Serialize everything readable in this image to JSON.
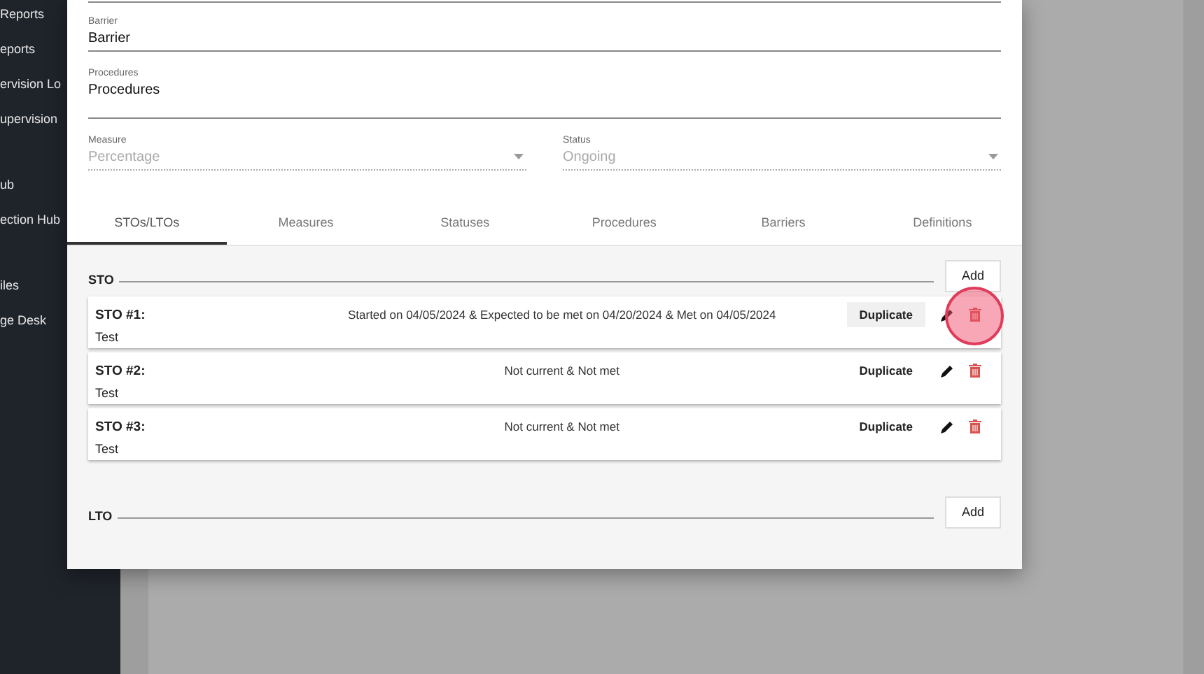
{
  "sidebar": {
    "items": [
      {
        "label": "Reports"
      },
      {
        "label": "eports"
      },
      {
        "label": "ervision Lo"
      },
      {
        "label": "upervision"
      },
      {
        "label": "ub"
      },
      {
        "label": "ection Hub"
      },
      {
        "label": "iles"
      },
      {
        "label": "ge Desk"
      }
    ]
  },
  "dialog": {
    "text_fields": [
      {
        "label": "Barrier",
        "value": "Barrier"
      },
      {
        "label": "Procedures",
        "value": "Procedures"
      }
    ],
    "selects": [
      {
        "label": "Measure",
        "value": "Percentage",
        "disabled": true
      },
      {
        "label": "Status",
        "value": "Ongoing",
        "disabled": true
      }
    ],
    "tabs": [
      {
        "label": "STOs/LTOs",
        "selected": true
      },
      {
        "label": "Measures",
        "selected": false
      },
      {
        "label": "Statuses",
        "selected": false
      },
      {
        "label": "Procedures",
        "selected": false
      },
      {
        "label": "Barriers",
        "selected": false
      },
      {
        "label": "Definitions",
        "selected": false
      }
    ],
    "sections": [
      {
        "title": "STO",
        "add_button": "Add",
        "items": [
          {
            "name": "STO #1:",
            "status": "Started on 04/05/2024 & Expected to be met on 04/20/2024 & Met on 04/05/2024",
            "description": "Test",
            "duplicate_button": "Duplicate",
            "highlighted": true
          },
          {
            "name": "STO #2:",
            "status": "Not current & Not met",
            "description": "Test",
            "duplicate_button": "Duplicate",
            "highlighted": false
          },
          {
            "name": "STO #3:",
            "status": "Not current & Not met",
            "description": "Test",
            "duplicate_button": "Duplicate",
            "highlighted": false
          }
        ]
      },
      {
        "title": "LTO",
        "add_button": "Add"
      }
    ]
  }
}
